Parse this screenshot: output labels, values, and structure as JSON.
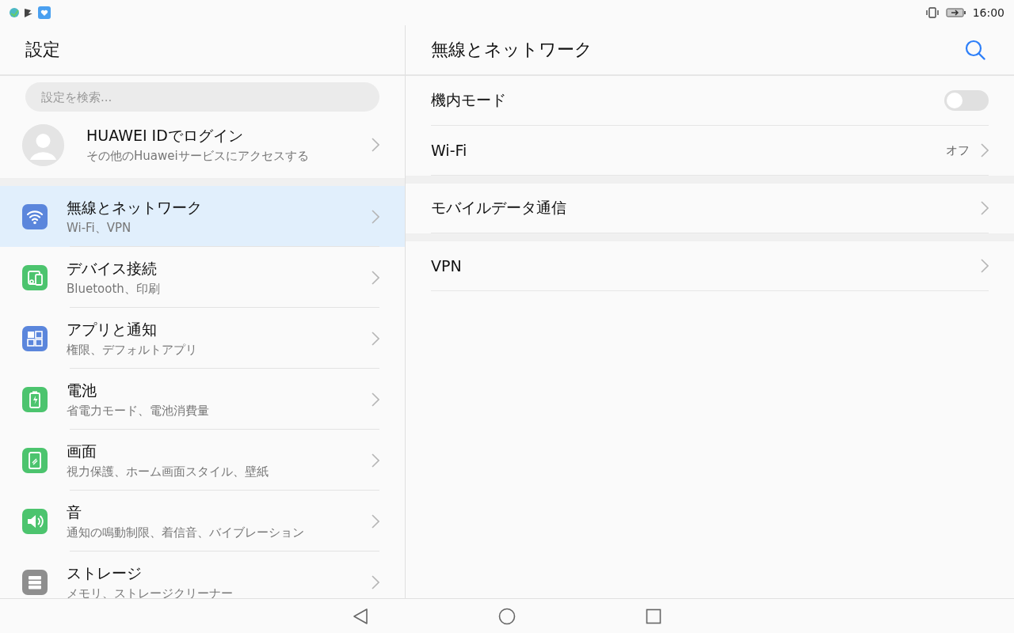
{
  "status_bar": {
    "time": "16:00"
  },
  "settings": {
    "title": "設定",
    "search": {
      "placeholder": "設定を検索..."
    },
    "account": {
      "title": "HUAWEI IDでログイン",
      "subtitle": "その他のHuaweiサービスにアクセスする"
    },
    "items": [
      {
        "title": "無線とネットワーク",
        "subtitle": "Wi-Fi、VPN",
        "kind": "wifi",
        "color": "#5b86dc",
        "selected": true
      },
      {
        "title": "デバイス接続",
        "subtitle": "Bluetooth、印刷",
        "kind": "devices",
        "color": "#4cc46e",
        "selected": false
      },
      {
        "title": "アプリと通知",
        "subtitle": "権限、デフォルトアプリ",
        "kind": "apps",
        "color": "#5b86dc",
        "selected": false
      },
      {
        "title": "電池",
        "subtitle": "省電力モード、電池消費量",
        "kind": "battery",
        "color": "#4cc46e",
        "selected": false
      },
      {
        "title": "画面",
        "subtitle": "視力保護、ホーム画面スタイル、壁紙",
        "kind": "screen",
        "color": "#4cc46e",
        "selected": false
      },
      {
        "title": "音",
        "subtitle": "通知の鳴動制限、着信音、バイブレーション",
        "kind": "sound",
        "color": "#4cc46e",
        "selected": false
      },
      {
        "title": "ストレージ",
        "subtitle": "メモリ、ストレージクリーナー",
        "kind": "storage",
        "color": "#8e8e8e",
        "selected": false
      }
    ]
  },
  "detail": {
    "title": "無線とネットワーク",
    "groups": [
      {
        "rows": [
          {
            "kind": "toggle",
            "label": "機内モード",
            "on": false
          },
          {
            "kind": "link",
            "label": "Wi-Fi",
            "value": "オフ"
          }
        ]
      },
      {
        "rows": [
          {
            "kind": "link",
            "label": "モバイルデータ通信"
          }
        ]
      },
      {
        "rows": [
          {
            "kind": "link",
            "label": "VPN"
          }
        ]
      }
    ]
  }
}
